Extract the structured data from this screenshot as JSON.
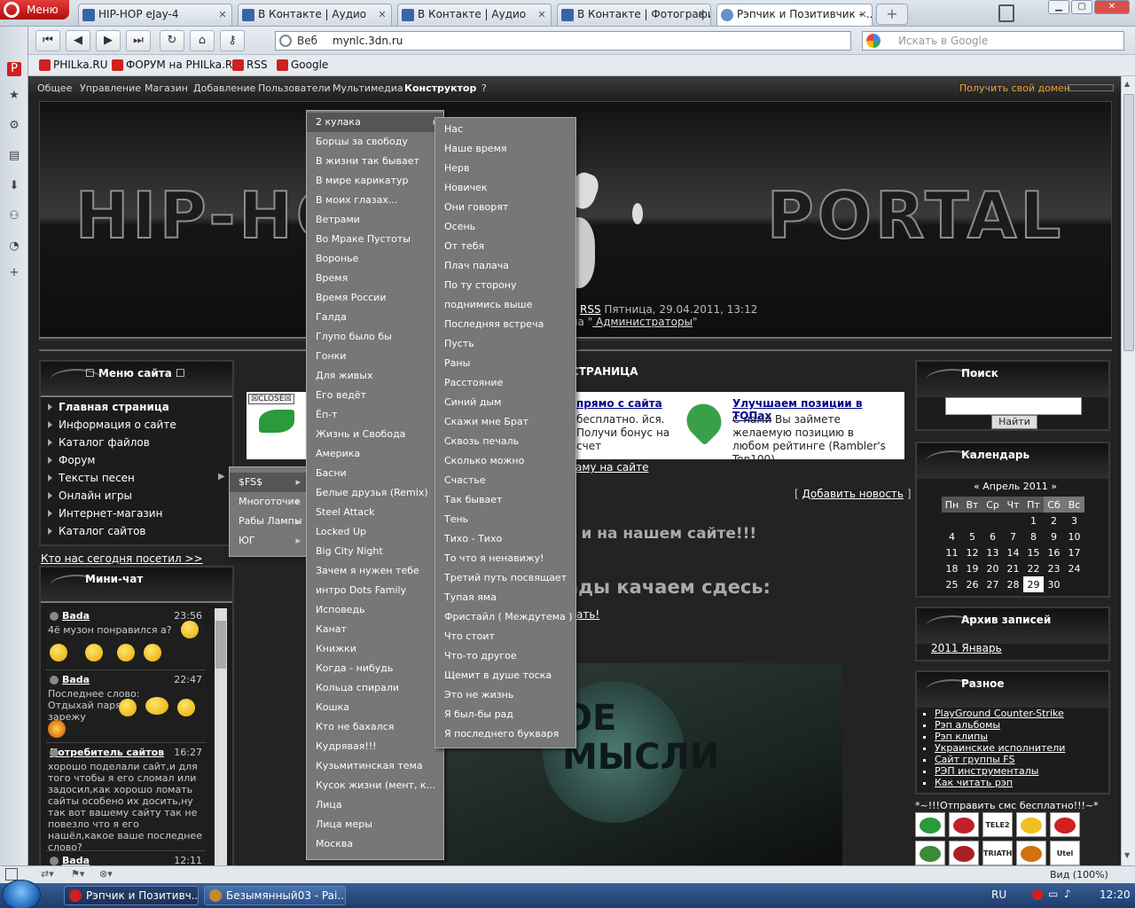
{
  "browser": {
    "menu_label": "Меню",
    "tabs": [
      {
        "label": "HIP-HOP eJay-4"
      },
      {
        "label": "В Контакте | Аудио"
      },
      {
        "label": "В Контакте | Аудио"
      },
      {
        "label": "В Контакте | Фотографии"
      },
      {
        "label": "Рэпчик и Позитивчик - ..."
      }
    ],
    "address_label": "Веб",
    "url": "mynlc.3dn.ru",
    "search_placeholder": "Искать в Google",
    "bookmarks": [
      "PHILka.RU",
      "ФОРУМ на PHILka.RU",
      "RSS",
      "Google"
    ]
  },
  "admin_bar": {
    "items": [
      "Общее",
      "Управление",
      "Магазин",
      "Добавление",
      "Пользователи",
      "Мультимедиа",
      "Конструктор",
      "?"
    ],
    "domain_link": "Получить свой домен"
  },
  "header": {
    "title_left": "HIP-HO",
    "title_right": "PORTAL",
    "rss": "RSS",
    "date": "Пятница, 29.04.2011, 13:12",
    "group_prefix": "пппа \"",
    "group_name": " Администраторы",
    "group_suffix": "\""
  },
  "site_menu": {
    "title": "☐ Меню сайта ☐",
    "items": [
      "Главная страница",
      "Информация о сайте",
      "Каталог файлов",
      "Форум",
      "Тексты песен",
      "Онлайн игры",
      "Интернет-магазин",
      "Каталог сайтов"
    ],
    "visitors_link": "Кто нас сегодня посетил >>"
  },
  "submenu_level1": {
    "items": [
      "$FS$",
      "Многоточие",
      "Рабы Лампы",
      "ЮГ"
    ]
  },
  "submenu_level2": {
    "items": [
      "2 кулака",
      "Борцы за свободу",
      "В жизни так бывает",
      "В мире карикатур",
      "В моих глазах...",
      "Ветрами",
      "Во Мраке Пустоты",
      "Воронье",
      "Время",
      "Время России",
      "Галда",
      "Глупо было бы",
      "Гонки",
      "Для живых",
      "Его ведёт",
      "Ёп-т",
      "Жизнь и Свобода",
      "Америка",
      "Басни",
      "Белые друзья (Remix)",
      "Steel Attack",
      "Locked Up",
      "Big City Night",
      "Зачем я нужен тебе",
      "интро Dots Family",
      "Исповедь",
      "Канат",
      "Книжки",
      "Когда - нибудь",
      "Кольца спирали",
      "Кошка",
      "Кто не бахался",
      "Кудрявая!!!",
      "Кузьмитинская тема",
      "Кусок жизни (мент, к...",
      "Лица",
      "Лица меры",
      "Москва"
    ]
  },
  "submenu_level3": {
    "items": [
      "Нас",
      "Наше время",
      "Нерв",
      "Новичек",
      "Они говорят",
      "Осень",
      "От тебя",
      "Плач палача",
      "По ту сторону",
      "поднимись выше",
      "Последняя встреча",
      "Пусть",
      "Раны",
      "Расстояние",
      "Синий дым",
      "Скажи мне Брат",
      "Сквозь печаль",
      "Сколько можно",
      "Счастье",
      "Так бывает",
      "Тень",
      "Тихо - Тихо",
      "То что я ненавижу!",
      "Третий путь посвящает",
      "Тупая яма",
      "Фристайл ( Междутема )",
      "Что стоит",
      "Что-то другое",
      "Щемит в душе тоска",
      "Это не жизнь",
      "Я был-бы рад",
      "Я последнего букваря"
    ]
  },
  "minichat": {
    "title": "Мини-чат",
    "messages": [
      {
        "nick": "Bada",
        "time": "23:56",
        "text": "4ё музон понравился а?"
      },
      {
        "nick": "Bada",
        "time": "22:47",
        "text": "Последнее слово: Отдыхай паря зарежу"
      },
      {
        "nick": "Потребитель сайтов",
        "time": "16:27",
        "text": "хорошо поделали сайт,и для того чтобы я его сломал или задосил,как хорошо ломать сайты особено их досить,ну так вот вашему сайту так не повезло что я его нашёл,какое ваше последнее слово?"
      },
      {
        "nick": "Bada",
        "time": "12:11",
        "text": ""
      }
    ]
  },
  "center": {
    "heading_partial": "СТРАНИЦА",
    "close_label": "CLOSE",
    "ad1_title": "прямо с сайта",
    "ad1_text": "бесплатно. йся. Получи бонус на счет",
    "ad2_title": "Улучшаем позиции в ТОПах",
    "ad2_text": "С нами Вы займете желаемую позицию в любом рейтинге (Rambler's Top100)",
    "ad_link": "аму на сайте",
    "add_news": "Добавить новость",
    "bracket_open": "[",
    "bracket_close": "]",
    "text1": "е и на нашем сайте!!!",
    "text2": "ады качаем сдесь:",
    "text3_link": "ать!",
    "poster_text": "ОЕ МЫСЛИ"
  },
  "search_block": {
    "title": "Поиск",
    "button": "Найти"
  },
  "calendar": {
    "title": "Календарь",
    "month": "Апрель 2011",
    "prev": "«",
    "next": "»",
    "weekdays": [
      "Пн",
      "Вт",
      "Ср",
      "Чт",
      "Пт",
      "Сб",
      "Вс"
    ],
    "weeks": [
      [
        "",
        "",
        "",
        "",
        "1",
        "2",
        "3"
      ],
      [
        "4",
        "5",
        "6",
        "7",
        "8",
        "9",
        "10"
      ],
      [
        "11",
        "12",
        "13",
        "14",
        "15",
        "16",
        "17"
      ],
      [
        "18",
        "19",
        "20",
        "21",
        "22",
        "23",
        "24"
      ],
      [
        "25",
        "26",
        "27",
        "28",
        "29",
        "30",
        ""
      ]
    ],
    "today": "29"
  },
  "archive": {
    "title": "Архив записей",
    "items": [
      "2011 Январь"
    ]
  },
  "misc": {
    "title": "Разное",
    "links": [
      "PlayGround Counter-Strike",
      "Рэп альбомы",
      "Рэп клипы",
      "Украинские исполнители",
      "Сайт группы FS",
      "РЭП инструменталы",
      "Как читать рэп"
    ]
  },
  "sms": {
    "title": "*~!!!Отправить смс бесплатно!!!~*",
    "operators": [
      "",
      "",
      "TELE2",
      "",
      "",
      "",
      "",
      "TRIATHL",
      "",
      "Utel"
    ]
  },
  "statusbar": {
    "zoom": "Вид (100%)"
  },
  "taskbar": {
    "tasks": [
      "Рэпчик и Позитивч...",
      "Безымянный03 - Pai..."
    ],
    "lang": "RU",
    "clock": "12:20"
  },
  "colors": {
    "accent": "#e8a23a",
    "opera_red": "#d02020",
    "link_blue": "#00008b"
  }
}
